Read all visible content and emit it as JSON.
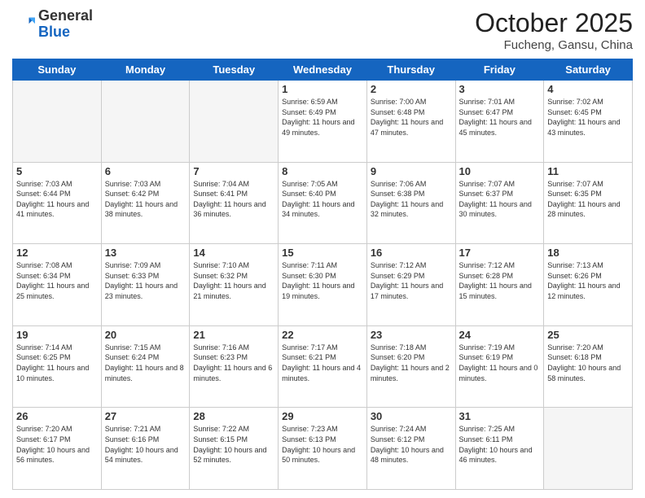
{
  "header": {
    "logo_general": "General",
    "logo_blue": "Blue",
    "month": "October 2025",
    "location": "Fucheng, Gansu, China"
  },
  "days_of_week": [
    "Sunday",
    "Monday",
    "Tuesday",
    "Wednesday",
    "Thursday",
    "Friday",
    "Saturday"
  ],
  "weeks": [
    [
      {
        "day": "",
        "info": ""
      },
      {
        "day": "",
        "info": ""
      },
      {
        "day": "",
        "info": ""
      },
      {
        "day": "1",
        "info": "Sunrise: 6:59 AM\nSunset: 6:49 PM\nDaylight: 11 hours and 49 minutes."
      },
      {
        "day": "2",
        "info": "Sunrise: 7:00 AM\nSunset: 6:48 PM\nDaylight: 11 hours and 47 minutes."
      },
      {
        "day": "3",
        "info": "Sunrise: 7:01 AM\nSunset: 6:47 PM\nDaylight: 11 hours and 45 minutes."
      },
      {
        "day": "4",
        "info": "Sunrise: 7:02 AM\nSunset: 6:45 PM\nDaylight: 11 hours and 43 minutes."
      }
    ],
    [
      {
        "day": "5",
        "info": "Sunrise: 7:03 AM\nSunset: 6:44 PM\nDaylight: 11 hours and 41 minutes."
      },
      {
        "day": "6",
        "info": "Sunrise: 7:03 AM\nSunset: 6:42 PM\nDaylight: 11 hours and 38 minutes."
      },
      {
        "day": "7",
        "info": "Sunrise: 7:04 AM\nSunset: 6:41 PM\nDaylight: 11 hours and 36 minutes."
      },
      {
        "day": "8",
        "info": "Sunrise: 7:05 AM\nSunset: 6:40 PM\nDaylight: 11 hours and 34 minutes."
      },
      {
        "day": "9",
        "info": "Sunrise: 7:06 AM\nSunset: 6:38 PM\nDaylight: 11 hours and 32 minutes."
      },
      {
        "day": "10",
        "info": "Sunrise: 7:07 AM\nSunset: 6:37 PM\nDaylight: 11 hours and 30 minutes."
      },
      {
        "day": "11",
        "info": "Sunrise: 7:07 AM\nSunset: 6:35 PM\nDaylight: 11 hours and 28 minutes."
      }
    ],
    [
      {
        "day": "12",
        "info": "Sunrise: 7:08 AM\nSunset: 6:34 PM\nDaylight: 11 hours and 25 minutes."
      },
      {
        "day": "13",
        "info": "Sunrise: 7:09 AM\nSunset: 6:33 PM\nDaylight: 11 hours and 23 minutes."
      },
      {
        "day": "14",
        "info": "Sunrise: 7:10 AM\nSunset: 6:32 PM\nDaylight: 11 hours and 21 minutes."
      },
      {
        "day": "15",
        "info": "Sunrise: 7:11 AM\nSunset: 6:30 PM\nDaylight: 11 hours and 19 minutes."
      },
      {
        "day": "16",
        "info": "Sunrise: 7:12 AM\nSunset: 6:29 PM\nDaylight: 11 hours and 17 minutes."
      },
      {
        "day": "17",
        "info": "Sunrise: 7:12 AM\nSunset: 6:28 PM\nDaylight: 11 hours and 15 minutes."
      },
      {
        "day": "18",
        "info": "Sunrise: 7:13 AM\nSunset: 6:26 PM\nDaylight: 11 hours and 12 minutes."
      }
    ],
    [
      {
        "day": "19",
        "info": "Sunrise: 7:14 AM\nSunset: 6:25 PM\nDaylight: 11 hours and 10 minutes."
      },
      {
        "day": "20",
        "info": "Sunrise: 7:15 AM\nSunset: 6:24 PM\nDaylight: 11 hours and 8 minutes."
      },
      {
        "day": "21",
        "info": "Sunrise: 7:16 AM\nSunset: 6:23 PM\nDaylight: 11 hours and 6 minutes."
      },
      {
        "day": "22",
        "info": "Sunrise: 7:17 AM\nSunset: 6:21 PM\nDaylight: 11 hours and 4 minutes."
      },
      {
        "day": "23",
        "info": "Sunrise: 7:18 AM\nSunset: 6:20 PM\nDaylight: 11 hours and 2 minutes."
      },
      {
        "day": "24",
        "info": "Sunrise: 7:19 AM\nSunset: 6:19 PM\nDaylight: 11 hours and 0 minutes."
      },
      {
        "day": "25",
        "info": "Sunrise: 7:20 AM\nSunset: 6:18 PM\nDaylight: 10 hours and 58 minutes."
      }
    ],
    [
      {
        "day": "26",
        "info": "Sunrise: 7:20 AM\nSunset: 6:17 PM\nDaylight: 10 hours and 56 minutes."
      },
      {
        "day": "27",
        "info": "Sunrise: 7:21 AM\nSunset: 6:16 PM\nDaylight: 10 hours and 54 minutes."
      },
      {
        "day": "28",
        "info": "Sunrise: 7:22 AM\nSunset: 6:15 PM\nDaylight: 10 hours and 52 minutes."
      },
      {
        "day": "29",
        "info": "Sunrise: 7:23 AM\nSunset: 6:13 PM\nDaylight: 10 hours and 50 minutes."
      },
      {
        "day": "30",
        "info": "Sunrise: 7:24 AM\nSunset: 6:12 PM\nDaylight: 10 hours and 48 minutes."
      },
      {
        "day": "31",
        "info": "Sunrise: 7:25 AM\nSunset: 6:11 PM\nDaylight: 10 hours and 46 minutes."
      },
      {
        "day": "",
        "info": ""
      }
    ]
  ]
}
